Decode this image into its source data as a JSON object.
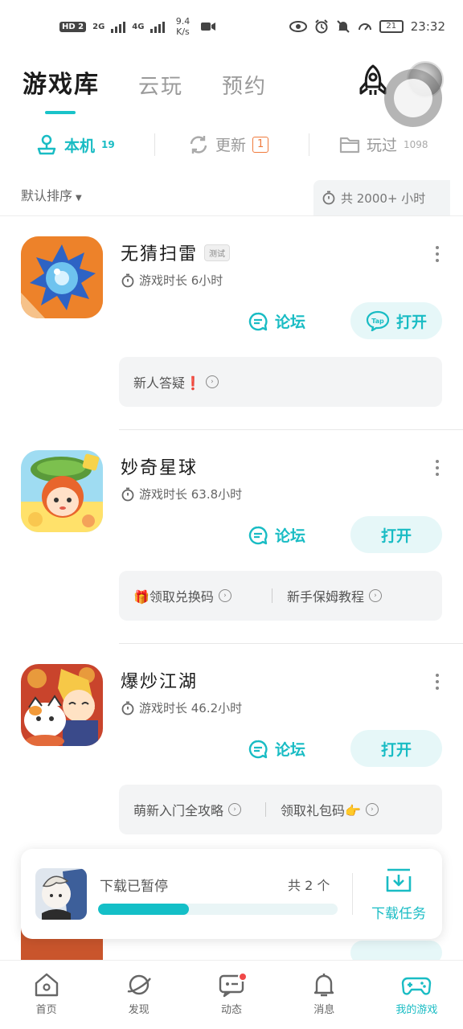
{
  "statusbar": {
    "hd": "HD",
    "sim": "2",
    "net1": "2G",
    "net2": "4G",
    "speed_value": "9.4",
    "speed_unit": "K/s",
    "time": "23:32",
    "battery": "21"
  },
  "top_tabs": [
    {
      "label": "游戏库",
      "active": true
    },
    {
      "label": "云玩",
      "active": false
    },
    {
      "label": "预约",
      "active": false
    }
  ],
  "sub_tabs": [
    {
      "label": "本机",
      "count": "19",
      "active": true
    },
    {
      "label": "更新",
      "count": "1",
      "active": false
    },
    {
      "label": "玩过",
      "count": "1098",
      "active": false
    }
  ],
  "sort": {
    "label": "默认排序"
  },
  "total_time": {
    "label": "共 2000+ 小时"
  },
  "games": [
    {
      "title": "无猜扫雷",
      "tag": "测试",
      "time": "游戏时长 6小时",
      "forum": "论坛",
      "open": "打开",
      "extras": [
        {
          "text": "新人答疑❗"
        }
      ]
    },
    {
      "title": "妙奇星球",
      "time": "游戏时长 63.8小时",
      "forum": "论坛",
      "open": "打开",
      "extras": [
        {
          "text": "🎁领取兑换码"
        },
        {
          "text": "新手保姆教程"
        }
      ]
    },
    {
      "title": "爆炒江湖",
      "time": "游戏时长 46.2小时",
      "forum": "论坛",
      "open": "打开",
      "extras": [
        {
          "text": "萌新入门全攻略"
        },
        {
          "text": "领取礼包码👉"
        }
      ]
    }
  ],
  "download": {
    "status": "下载已暂停",
    "count": "共 2 个",
    "progress": 0.38,
    "task_label": "下载任务"
  },
  "nav": [
    {
      "label": "首页",
      "icon": "home-icon"
    },
    {
      "label": "发现",
      "icon": "planet-icon"
    },
    {
      "label": "动态",
      "icon": "chat-icon"
    },
    {
      "label": "消息",
      "icon": "bell-icon"
    },
    {
      "label": "我的游戏",
      "icon": "gamepad-icon",
      "active": true
    }
  ],
  "colors": {
    "accent": "#19bcc4",
    "badge": "#f07a3c",
    "dot": "#f04848"
  }
}
